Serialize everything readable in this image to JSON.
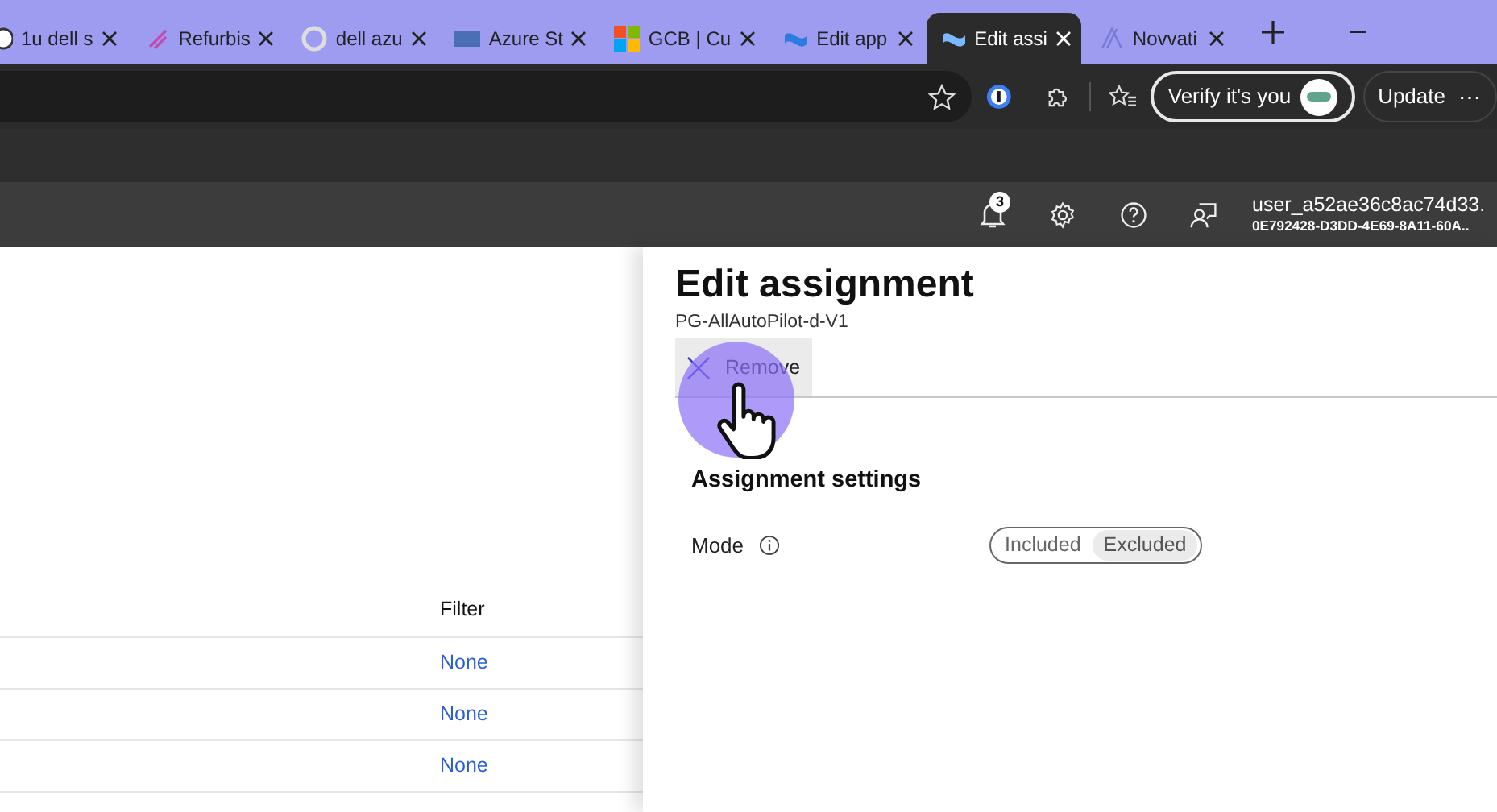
{
  "browser": {
    "tabs": [
      {
        "title": "1u dell s",
        "selected": false
      },
      {
        "title": "Refurbis",
        "selected": false
      },
      {
        "title": "dell azu",
        "selected": false
      },
      {
        "title": "Azure St",
        "selected": false
      },
      {
        "title": "GCB | Cu",
        "selected": false
      },
      {
        "title": "Edit app",
        "selected": false
      },
      {
        "title": "Edit assi",
        "selected": true
      },
      {
        "title": "Novvati",
        "selected": false
      }
    ],
    "toolbar": {
      "verify_button": "Verify it's you",
      "update_button": "Update",
      "more_glyph": "⋯"
    }
  },
  "portal_header": {
    "notification_count": "3",
    "user_name": "user_a52ae36c8ac74d33.",
    "tenant_id": "0E792428-D3DD-4E69-8A11-60A.."
  },
  "table": {
    "columns": [
      "Filter"
    ],
    "rows": [
      {
        "filter": "None"
      },
      {
        "filter": "None"
      },
      {
        "filter": "None"
      }
    ]
  },
  "panel": {
    "title": "Edit assignment",
    "subtitle": "PG-AllAutoPilot-d-V1",
    "remove_button": "Remove",
    "section_title": "Assignment settings",
    "mode": {
      "label": "Mode",
      "options": [
        {
          "label": "Included",
          "selected": false
        },
        {
          "label": "Excluded",
          "selected": true
        }
      ]
    }
  }
}
